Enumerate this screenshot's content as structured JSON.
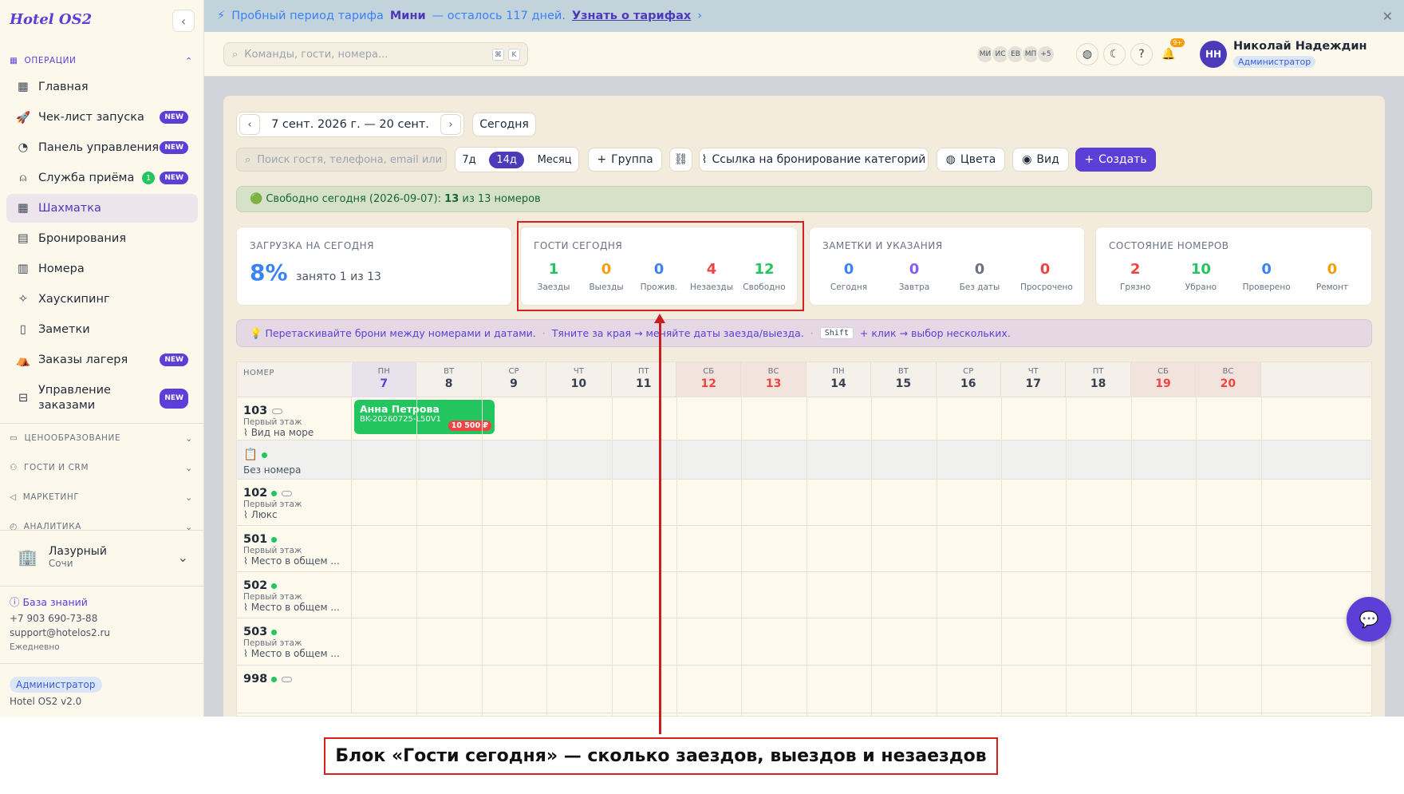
{
  "app": {
    "brand": "Hotel OS2"
  },
  "sidebar": {
    "section_ops": "ОПЕРАЦИИ",
    "items": [
      {
        "label": "Главная",
        "icon": "grid-icon"
      },
      {
        "label": "Чек-лист запуска",
        "icon": "rocket-icon",
        "badge": "NEW"
      },
      {
        "label": "Панель управления",
        "icon": "gauge-icon",
        "badge": "NEW"
      },
      {
        "label": "Служба приёма",
        "icon": "bell-desk-icon",
        "count": "1",
        "badge": "NEW"
      },
      {
        "label": "Шахматка",
        "icon": "table-icon"
      },
      {
        "label": "Бронирования",
        "icon": "clipboard-icon"
      },
      {
        "label": "Номера",
        "icon": "building-icon"
      },
      {
        "label": "Хаускипинг",
        "icon": "sparkle-icon"
      },
      {
        "label": "Заметки",
        "icon": "note-icon"
      },
      {
        "label": "Заказы лагеря",
        "icon": "tent-icon",
        "badge": "NEW"
      },
      {
        "label": "Управление заказами",
        "icon": "receipt-icon",
        "badge": "NEW"
      }
    ],
    "sections": [
      "ЦЕНООБРАЗОВАНИЕ",
      "ГОСТИ И CRM",
      "МАРКЕТИНГ",
      "АНАЛИТИКА"
    ],
    "hotel": {
      "name": "Лазурный",
      "city": "Сочи"
    },
    "kb": "База знаний",
    "phone": "+7 903 690-73-88",
    "email": "support@hotelos2.ru",
    "daily": "Ежедневно",
    "role": "Администратор",
    "version": "Hotel OS2 v2.0"
  },
  "banner": {
    "pre": "Пробный период тарифа",
    "plan": "Мини",
    "mid": "— осталось 117 дней.",
    "link": "Узнать о тарифах"
  },
  "topbar": {
    "search_placeholder": "Команды, гости, номера...",
    "kbd1": "⌘",
    "kbd2": "K",
    "avatars": [
      "МИ",
      "ИС",
      "ЕВ",
      "МП",
      "+5"
    ],
    "notif": "9+",
    "user": {
      "initials": "НН",
      "name": "Николай Надеждин",
      "role": "Администратор"
    }
  },
  "toolbar": {
    "date_range": "7 сент. 2026 г. — 20 сент.",
    "today": "Сегодня",
    "guest_search": "Поиск гостя, телефона, email или",
    "views": [
      "7д",
      "14д",
      "Месяц"
    ],
    "group": "Группа",
    "booking_link": "Ссылка на бронирование категорий",
    "colors": "Цвета",
    "view": "Вид",
    "create": "Создать"
  },
  "free_today": {
    "pre": "Свободно сегодня (2026-09-07):",
    "free": "13",
    "mid": "из 13 номеров"
  },
  "stats": {
    "load": {
      "title": "ЗАГРУЗКА НА СЕГОДНЯ",
      "percent": "8%",
      "sub": "занято 1 из 13"
    },
    "guests": {
      "title": "ГОСТИ СЕГОДНЯ",
      "items": [
        {
          "v": "1",
          "l": "Заезды",
          "c": "#22c55e"
        },
        {
          "v": "0",
          "l": "Выезды",
          "c": "#f59e0b"
        },
        {
          "v": "0",
          "l": "Прожив.",
          "c": "#3b82f6"
        },
        {
          "v": "4",
          "l": "Незаезды",
          "c": "#ef4444"
        },
        {
          "v": "12",
          "l": "Свободно",
          "c": "#22c55e"
        }
      ]
    },
    "notes": {
      "title": "ЗАМЕТКИ И УКАЗАНИЯ",
      "items": [
        {
          "v": "0",
          "l": "Сегодня",
          "c": "#3b82f6"
        },
        {
          "v": "0",
          "l": "Завтра",
          "c": "#8b5cf6"
        },
        {
          "v": "0",
          "l": "Без даты",
          "c": "#6b7280"
        },
        {
          "v": "0",
          "l": "Просрочено",
          "c": "#ef4444"
        }
      ]
    },
    "rooms": {
      "title": "СОСТОЯНИЕ НОМЕРОВ",
      "items": [
        {
          "v": "2",
          "l": "Грязно",
          "c": "#ef4444"
        },
        {
          "v": "10",
          "l": "Убрано",
          "c": "#22c55e"
        },
        {
          "v": "0",
          "l": "Проверено",
          "c": "#3b82f6"
        },
        {
          "v": "0",
          "l": "Ремонт",
          "c": "#f59e0b"
        }
      ]
    }
  },
  "tip": {
    "a": "💡 Перетаскивайте брони между номерами и датами.",
    "b": "Тяните за края → меняйте даты заезда/выезда.",
    "key": "Shift",
    "c": "+ клик → выбор нескольких."
  },
  "grid": {
    "header": "НОМЕР",
    "days": [
      {
        "dw": "ПН",
        "dn": "7",
        "kind": "today"
      },
      {
        "dw": "ВТ",
        "dn": "8"
      },
      {
        "dw": "СР",
        "dn": "9"
      },
      {
        "dw": "ЧТ",
        "dn": "10"
      },
      {
        "dw": "ПТ",
        "dn": "11"
      },
      {
        "dw": "СБ",
        "dn": "12",
        "kind": "we"
      },
      {
        "dw": "ВС",
        "dn": "13",
        "kind": "we"
      },
      {
        "dw": "ПН",
        "dn": "14"
      },
      {
        "dw": "ВТ",
        "dn": "15"
      },
      {
        "dw": "СР",
        "dn": "16"
      },
      {
        "dw": "ЧТ",
        "dn": "17"
      },
      {
        "dw": "ПТ",
        "dn": "18"
      },
      {
        "dw": "СБ",
        "dn": "19",
        "kind": "we"
      },
      {
        "dw": "ВС",
        "dn": "20",
        "kind": "we"
      }
    ],
    "rooms": [
      {
        "num": "103",
        "floor": "Первый этаж",
        "cat": "Вид на море"
      },
      {
        "num": "📋",
        "floor": "",
        "cat": "Без номера"
      },
      {
        "num": "102",
        "floor": "Первый этаж",
        "cat": "Люкс"
      },
      {
        "num": "501",
        "floor": "Первый этаж",
        "cat": "Место в общем ..."
      },
      {
        "num": "502",
        "floor": "Первый этаж",
        "cat": "Место в общем ..."
      },
      {
        "num": "503",
        "floor": "Первый этаж",
        "cat": "Место в общем ..."
      },
      {
        "num": "998",
        "floor": "",
        "cat": ""
      }
    ],
    "booking": {
      "guest": "Анна Петрова",
      "code": "BK-20260725-L50V1",
      "price": "10 500 ₽"
    }
  },
  "annotation": {
    "caption": "Блок «Гости сегодня» — сколько заездов, выездов и незаездов"
  }
}
